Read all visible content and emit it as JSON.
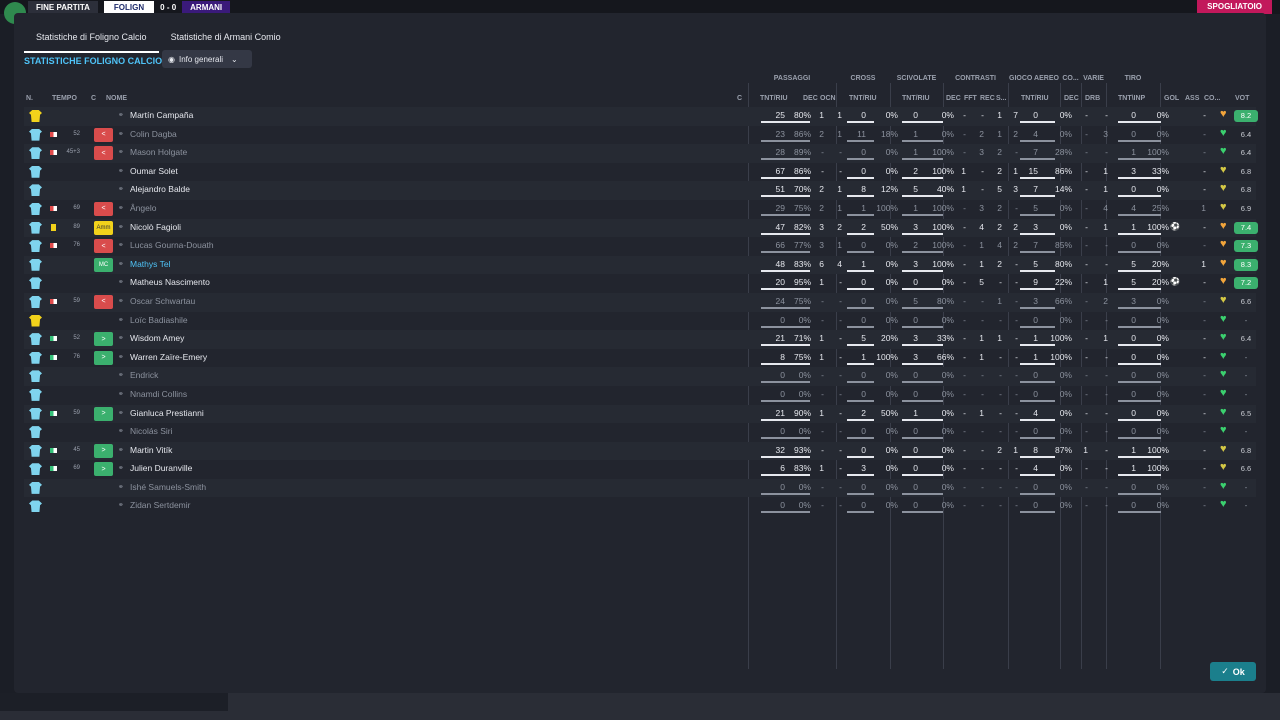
{
  "background": {
    "match_label": "FINE PARTITA",
    "home_team": "FOLIGN",
    "away_team": "ARMANI",
    "score_sep": "0 - 0",
    "right_button": "SPOGLIATOIO"
  },
  "tabs": [
    {
      "label": "Statistiche di Foligno Calcio",
      "active": true
    },
    {
      "label": "Statistiche di Armani Comio",
      "active": false
    }
  ],
  "section_title": "STATISTICHE FOLIGNO CALCIO",
  "view_dropdown": {
    "label": "Info generali",
    "icon": "eye-icon"
  },
  "groups": {
    "passaggi": "PASSAGGI",
    "cross": "CROSS",
    "scivolate": "SCIVOLATE",
    "contrasti": "CONTRASTI",
    "gioco_aereo": "GIOCO AEREO",
    "co": "CO...",
    "varie": "VARIE",
    "tiro": "TIRO"
  },
  "headers": {
    "n": "N.",
    "tempo": "TEMPO",
    "c": "C",
    "nome": "NOME",
    "c2": "C",
    "tnt_riu": "TNT/RIU",
    "dec": "DEC",
    "ocn": "OCN",
    "cross_tnt_riu": "TNT/RIU",
    "sciv_tnt_riu": "TNT/RIU",
    "con_dec": "DEC",
    "fft": "FFT",
    "rec": "REC",
    "s": "S...",
    "aereo_tnt_riu": "TNT/RIU",
    "co_dec": "DEC",
    "drb": "DRB",
    "tiro_tnt_inp": "TNT\\INP",
    "gol": "GOL",
    "ass": "ASS",
    "co2": "CO...",
    "vot": "VOT"
  },
  "players": [
    {
      "name": "Martín Campaña",
      "gk": true,
      "mins": "",
      "status": "",
      "badge": "",
      "pas": "25",
      "pasp": "80%",
      "dec": "1",
      "ocn": "1",
      "cr": "0",
      "crp": "0%",
      "sc": "0",
      "scp": "0%",
      "cd": "-",
      "fft": "-",
      "rec": "1",
      "s": "7",
      "ae": "0",
      "aep": "0%",
      "codec": "-",
      "drb": "-",
      "ti": "0",
      "tip": "0%",
      "gol": "",
      "ass": "-",
      "vot": "8.2",
      "votc": "#3bb06e",
      "dim": false,
      "hl": false
    },
    {
      "name": "Colin Dagba",
      "gk": false,
      "mins": "52",
      "status": "out",
      "badge": "out",
      "pas": "23",
      "pasp": "86%",
      "dec": "2",
      "ocn": "1",
      "cr": "11",
      "crp": "18%",
      "sc": "1",
      "scp": "0%",
      "cd": "-",
      "fft": "2",
      "rec": "1",
      "s": "2",
      "ae": "4",
      "aep": "0%",
      "codec": "-",
      "drb": "3",
      "ti": "0",
      "tip": "0%",
      "gol": "",
      "ass": "-",
      "vot": "6.4",
      "votc": "",
      "dim": true,
      "hl": false
    },
    {
      "name": "Mason Holgate",
      "gk": false,
      "mins": "45+3",
      "status": "out",
      "badge": "out",
      "pas": "28",
      "pasp": "89%",
      "dec": "-",
      "ocn": "-",
      "cr": "0",
      "crp": "0%",
      "sc": "1",
      "scp": "100%",
      "cd": "-",
      "fft": "3",
      "rec": "2",
      "s": "-",
      "ae": "7",
      "aep": "28%",
      "codec": "-",
      "drb": "-",
      "ti": "1",
      "tip": "100%",
      "gol": "",
      "ass": "-",
      "vot": "6.4",
      "votc": "",
      "dim": true,
      "hl": false
    },
    {
      "name": "Oumar Solet",
      "gk": false,
      "mins": "",
      "status": "",
      "badge": "",
      "pas": "67",
      "pasp": "86%",
      "dec": "-",
      "ocn": "-",
      "cr": "0",
      "crp": "0%",
      "sc": "2",
      "scp": "100%",
      "cd": "1",
      "fft": "-",
      "rec": "2",
      "s": "1",
      "ae": "15",
      "aep": "86%",
      "codec": "-",
      "drb": "1",
      "ti": "3",
      "tip": "33%",
      "gol": "",
      "ass": "-",
      "vot": "6.8",
      "votc": "",
      "dim": false,
      "hl": false
    },
    {
      "name": "Alejandro Balde",
      "gk": false,
      "mins": "",
      "status": "",
      "badge": "",
      "pas": "51",
      "pasp": "70%",
      "dec": "2",
      "ocn": "1",
      "cr": "8",
      "crp": "12%",
      "sc": "5",
      "scp": "40%",
      "cd": "1",
      "fft": "-",
      "rec": "5",
      "s": "3",
      "ae": "7",
      "aep": "14%",
      "codec": "-",
      "drb": "1",
      "ti": "0",
      "tip": "0%",
      "gol": "",
      "ass": "-",
      "vot": "6.8",
      "votc": "",
      "dim": false,
      "hl": false
    },
    {
      "name": "Ângelo",
      "gk": false,
      "mins": "69",
      "status": "out",
      "badge": "out",
      "pas": "29",
      "pasp": "75%",
      "dec": "2",
      "ocn": "1",
      "cr": "1",
      "crp": "100%",
      "sc": "1",
      "scp": "100%",
      "cd": "-",
      "fft": "3",
      "rec": "2",
      "s": "-",
      "ae": "5",
      "aep": "0%",
      "codec": "-",
      "drb": "4",
      "ti": "4",
      "tip": "25%",
      "gol": "",
      "ass": "1",
      "vot": "6.9",
      "votc": "",
      "dim": true,
      "hl": false
    },
    {
      "name": "Nicolò Fagioli",
      "gk": false,
      "mins": "89",
      "status": "card",
      "badge": "amm",
      "pas": "47",
      "pasp": "82%",
      "dec": "3",
      "ocn": "2",
      "cr": "2",
      "crp": "50%",
      "sc": "3",
      "scp": "100%",
      "cd": "-",
      "fft": "4",
      "rec": "2",
      "s": "2",
      "ae": "3",
      "aep": "0%",
      "codec": "-",
      "drb": "1",
      "ti": "1",
      "tip": "100%",
      "gol": "⚽",
      "ass": "-",
      "vot": "7.4",
      "votc": "#3bb06e",
      "dim": false,
      "hl": false
    },
    {
      "name": "Lucas Gourna-Douath",
      "gk": false,
      "mins": "76",
      "status": "out",
      "badge": "out",
      "pas": "66",
      "pasp": "77%",
      "dec": "3",
      "ocn": "1",
      "cr": "0",
      "crp": "0%",
      "sc": "2",
      "scp": "100%",
      "cd": "-",
      "fft": "1",
      "rec": "4",
      "s": "2",
      "ae": "7",
      "aep": "85%",
      "codec": "-",
      "drb": "-",
      "ti": "0",
      "tip": "0%",
      "gol": "",
      "ass": "-",
      "vot": "7.3",
      "votc": "#3bb06e",
      "dim": true,
      "hl": false
    },
    {
      "name": "Mathys Tel",
      "gk": false,
      "mins": "",
      "status": "",
      "badge": "mc",
      "pas": "48",
      "pasp": "83%",
      "dec": "6",
      "ocn": "4",
      "cr": "1",
      "crp": "0%",
      "sc": "3",
      "scp": "100%",
      "cd": "-",
      "fft": "1",
      "rec": "2",
      "s": "-",
      "ae": "5",
      "aep": "80%",
      "codec": "-",
      "drb": "-",
      "ti": "5",
      "tip": "20%",
      "gol": "",
      "ass": "1",
      "vot": "8.3",
      "votc": "#3bb06e",
      "dim": false,
      "hl": true
    },
    {
      "name": "Matheus Nascimento",
      "gk": false,
      "mins": "",
      "status": "",
      "badge": "",
      "pas": "20",
      "pasp": "95%",
      "dec": "1",
      "ocn": "-",
      "cr": "0",
      "crp": "0%",
      "sc": "0",
      "scp": "0%",
      "cd": "-",
      "fft": "5",
      "rec": "-",
      "s": "-",
      "ae": "9",
      "aep": "22%",
      "codec": "-",
      "drb": "1",
      "ti": "5",
      "tip": "20%",
      "gol": "⚽",
      "ass": "-",
      "vot": "7.2",
      "votc": "#3bb06e",
      "dim": false,
      "hl": false
    },
    {
      "name": "Oscar Schwartau",
      "gk": false,
      "mins": "59",
      "status": "out",
      "badge": "out",
      "pas": "24",
      "pasp": "75%",
      "dec": "-",
      "ocn": "-",
      "cr": "0",
      "crp": "0%",
      "sc": "5",
      "scp": "80%",
      "cd": "-",
      "fft": "-",
      "rec": "1",
      "s": "-",
      "ae": "3",
      "aep": "66%",
      "codec": "-",
      "drb": "2",
      "ti": "3",
      "tip": "0%",
      "gol": "",
      "ass": "-",
      "vot": "6.6",
      "votc": "",
      "dim": true,
      "hl": false
    },
    {
      "name": "Loïc Badiashile",
      "gk": true,
      "mins": "",
      "status": "",
      "badge": "",
      "pas": "0",
      "pasp": "0%",
      "dec": "-",
      "ocn": "-",
      "cr": "0",
      "crp": "0%",
      "sc": "0",
      "scp": "0%",
      "cd": "-",
      "fft": "-",
      "rec": "-",
      "s": "-",
      "ae": "0",
      "aep": "0%",
      "codec": "-",
      "drb": "-",
      "ti": "0",
      "tip": "0%",
      "gol": "",
      "ass": "-",
      "vot": "-",
      "votc": "plain",
      "dim": true,
      "hl": false
    },
    {
      "name": "Wisdom Amey",
      "gk": false,
      "mins": "52",
      "status": "in",
      "badge": "in",
      "pas": "21",
      "pasp": "71%",
      "dec": "1",
      "ocn": "-",
      "cr": "5",
      "crp": "20%",
      "sc": "3",
      "scp": "33%",
      "cd": "-",
      "fft": "1",
      "rec": "1",
      "s": "-",
      "ae": "1",
      "aep": "100%",
      "codec": "-",
      "drb": "1",
      "ti": "0",
      "tip": "0%",
      "gol": "",
      "ass": "-",
      "vot": "6.4",
      "votc": "",
      "dim": false,
      "hl": false
    },
    {
      "name": "Warren Zaïre-Emery",
      "gk": false,
      "mins": "76",
      "status": "in",
      "badge": "in",
      "pas": "8",
      "pasp": "75%",
      "dec": "1",
      "ocn": "-",
      "cr": "1",
      "crp": "100%",
      "sc": "3",
      "scp": "66%",
      "cd": "-",
      "fft": "1",
      "rec": "-",
      "s": "-",
      "ae": "1",
      "aep": "100%",
      "codec": "-",
      "drb": "-",
      "ti": "0",
      "tip": "0%",
      "gol": "",
      "ass": "-",
      "vot": "-",
      "votc": "plain",
      "dim": false,
      "hl": false
    },
    {
      "name": "Endrick",
      "gk": false,
      "mins": "",
      "status": "",
      "badge": "",
      "pas": "0",
      "pasp": "0%",
      "dec": "-",
      "ocn": "-",
      "cr": "0",
      "crp": "0%",
      "sc": "0",
      "scp": "0%",
      "cd": "-",
      "fft": "-",
      "rec": "-",
      "s": "-",
      "ae": "0",
      "aep": "0%",
      "codec": "-",
      "drb": "-",
      "ti": "0",
      "tip": "0%",
      "gol": "",
      "ass": "-",
      "vot": "-",
      "votc": "plain",
      "dim": true,
      "hl": false
    },
    {
      "name": "Nnamdi Collins",
      "gk": false,
      "mins": "",
      "status": "",
      "badge": "",
      "pas": "0",
      "pasp": "0%",
      "dec": "-",
      "ocn": "-",
      "cr": "0",
      "crp": "0%",
      "sc": "0",
      "scp": "0%",
      "cd": "-",
      "fft": "-",
      "rec": "-",
      "s": "-",
      "ae": "0",
      "aep": "0%",
      "codec": "-",
      "drb": "-",
      "ti": "0",
      "tip": "0%",
      "gol": "",
      "ass": "-",
      "vot": "-",
      "votc": "plain",
      "dim": true,
      "hl": false
    },
    {
      "name": "Gianluca Prestianni",
      "gk": false,
      "mins": "59",
      "status": "in",
      "badge": "in",
      "pas": "21",
      "pasp": "90%",
      "dec": "1",
      "ocn": "-",
      "cr": "2",
      "crp": "50%",
      "sc": "1",
      "scp": "0%",
      "cd": "-",
      "fft": "1",
      "rec": "-",
      "s": "-",
      "ae": "4",
      "aep": "0%",
      "codec": "-",
      "drb": "-",
      "ti": "0",
      "tip": "0%",
      "gol": "",
      "ass": "-",
      "vot": "6.5",
      "votc": "",
      "dim": false,
      "hl": false
    },
    {
      "name": "Nicolás Siri",
      "gk": false,
      "mins": "",
      "status": "",
      "badge": "",
      "pas": "0",
      "pasp": "0%",
      "dec": "-",
      "ocn": "-",
      "cr": "0",
      "crp": "0%",
      "sc": "0",
      "scp": "0%",
      "cd": "-",
      "fft": "-",
      "rec": "-",
      "s": "-",
      "ae": "0",
      "aep": "0%",
      "codec": "-",
      "drb": "-",
      "ti": "0",
      "tip": "0%",
      "gol": "",
      "ass": "-",
      "vot": "-",
      "votc": "plain",
      "dim": true,
      "hl": false
    },
    {
      "name": "Martin Vitík",
      "gk": false,
      "mins": "45",
      "status": "in",
      "badge": "in",
      "pas": "32",
      "pasp": "93%",
      "dec": "-",
      "ocn": "-",
      "cr": "0",
      "crp": "0%",
      "sc": "0",
      "scp": "0%",
      "cd": "-",
      "fft": "-",
      "rec": "2",
      "s": "1",
      "ae": "8",
      "aep": "87%",
      "codec": "1",
      "drb": "-",
      "ti": "1",
      "tip": "100%",
      "gol": "",
      "ass": "-",
      "vot": "6.8",
      "votc": "",
      "dim": false,
      "hl": false
    },
    {
      "name": "Julien Duranville",
      "gk": false,
      "mins": "69",
      "status": "in",
      "badge": "in",
      "pas": "6",
      "pasp": "83%",
      "dec": "1",
      "ocn": "-",
      "cr": "3",
      "crp": "0%",
      "sc": "0",
      "scp": "0%",
      "cd": "-",
      "fft": "-",
      "rec": "-",
      "s": "-",
      "ae": "4",
      "aep": "0%",
      "codec": "-",
      "drb": "-",
      "ti": "1",
      "tip": "100%",
      "gol": "",
      "ass": "-",
      "vot": "6.6",
      "votc": "",
      "dim": false,
      "hl": false
    },
    {
      "name": "Ishé Samuels-Smith",
      "gk": false,
      "mins": "",
      "status": "",
      "badge": "",
      "pas": "0",
      "pasp": "0%",
      "dec": "-",
      "ocn": "-",
      "cr": "0",
      "crp": "0%",
      "sc": "0",
      "scp": "0%",
      "cd": "-",
      "fft": "-",
      "rec": "-",
      "s": "-",
      "ae": "0",
      "aep": "0%",
      "codec": "-",
      "drb": "-",
      "ti": "0",
      "tip": "0%",
      "gol": "",
      "ass": "-",
      "vot": "-",
      "votc": "plain",
      "dim": true,
      "hl": false
    },
    {
      "name": "Zidan Sertdemir",
      "gk": false,
      "mins": "",
      "status": "",
      "badge": "",
      "pas": "0",
      "pasp": "0%",
      "dec": "-",
      "ocn": "-",
      "cr": "0",
      "crp": "0%",
      "sc": "0",
      "scp": "0%",
      "cd": "-",
      "fft": "-",
      "rec": "-",
      "s": "-",
      "ae": "0",
      "aep": "0%",
      "codec": "-",
      "drb": "-",
      "ti": "0",
      "tip": "0%",
      "gol": "",
      "ass": "-",
      "vot": "-",
      "votc": "plain",
      "dim": true,
      "hl": false
    }
  ],
  "badges": {
    "amm": "Amm",
    "mc": "MC",
    "out": "<",
    "in": ">"
  },
  "ok_button": {
    "label": "Ok",
    "icon": "check-icon"
  },
  "colors": {
    "accent": "#4fc3f7",
    "ok": "#1b7f8c",
    "sub_out": "#d94c4c",
    "sub_in": "#3bb06e",
    "rating_high": "#3bb06e",
    "card_yellow": "#f2d21b"
  }
}
